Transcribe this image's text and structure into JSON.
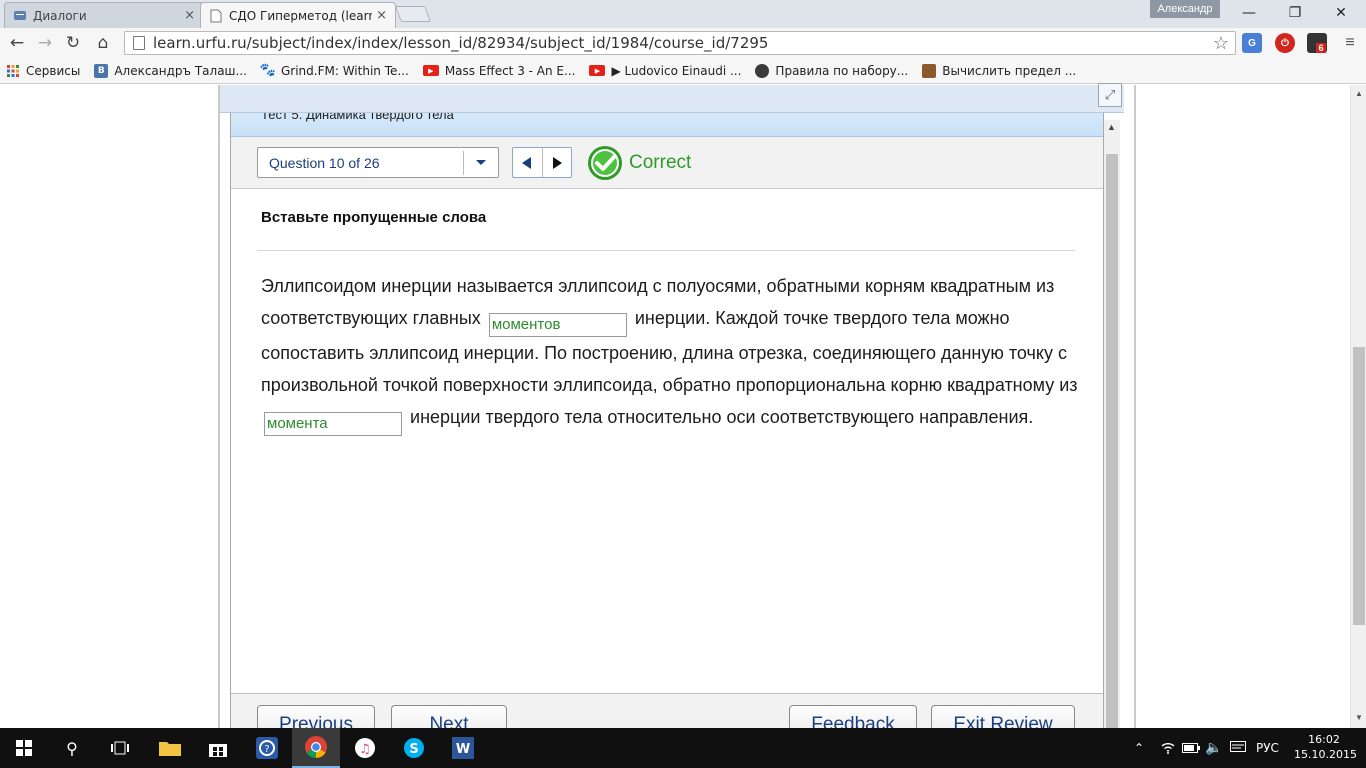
{
  "browser": {
    "tabs": [
      {
        "title": "Диалоги",
        "active": false
      },
      {
        "title": "СДО Гиперметод (learn.u",
        "active": true
      }
    ],
    "user_name": "Александр",
    "url": "learn.urfu.ru/subject/index/index/lesson_id/82934/subject_id/1984/course_id/7295",
    "extension_badge": "6",
    "bookmarks": [
      {
        "label": "Сервисы",
        "icon": "apps-grid-icon",
        "color": "#e04b3a"
      },
      {
        "label": "Александръ Талаш...",
        "icon": "vk-icon",
        "color": "#4a76a8"
      },
      {
        "label": "Grind.FM: Within Te...",
        "icon": "paw-icon",
        "color": "#222222"
      },
      {
        "label": "Mass Effect 3 - An E...",
        "icon": "youtube-icon",
        "color": "#e62117"
      },
      {
        "label": "▶ Ludovico Einaudi ...",
        "icon": "youtube-icon",
        "color": "#e62117"
      },
      {
        "label": "Правила по набору...",
        "icon": "globe-icon",
        "color": "#3a3a3a"
      },
      {
        "label": "Вычислить предел ...",
        "icon": "figure-icon",
        "color": "#8a5a2b"
      }
    ]
  },
  "quiz": {
    "title": "Тест 5. Динамика твердого тела",
    "question_selector": "Question 10 of 26",
    "status": "Correct",
    "prompt": "Вставьте пропущенные слова",
    "passage": {
      "part1": "Эллипсоидом инерции называется эллипсоид с полуосями, обратными корням квадратным из соответствующих главных",
      "blank1": "моментов",
      "part2": "инерции. Каждой точке твердого тела можно сопоставить эллипсоид инерции. По построению, длина отрезка, соединяющего данную точку с произвольной точкой поверхности эллипсоида, обратно пропорциональна корню квадратному из",
      "blank2": "момента",
      "part3": "инерции твердого тела относительно оси соответствующего направления."
    },
    "footer": {
      "previous": "Previous",
      "next": "Next",
      "feedback": "Feedback",
      "exit_review": "Exit Review"
    }
  },
  "taskbar": {
    "language": "РУС",
    "time": "16:02",
    "date": "15.10.2015"
  },
  "colors": {
    "correct_green": "#2f9a2a",
    "link_blue": "#1a3f80",
    "title_bar_blue": "#c8e0f6"
  }
}
